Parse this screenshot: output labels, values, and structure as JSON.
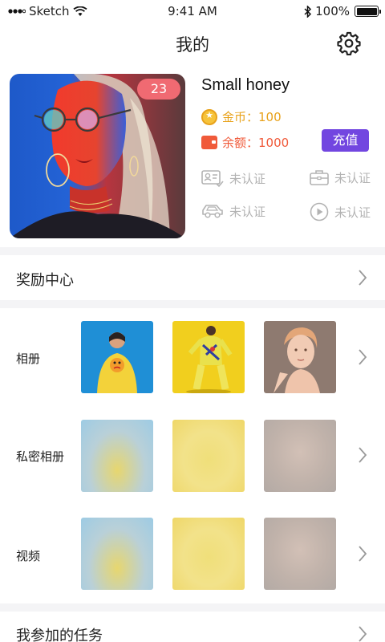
{
  "status_bar": {
    "carrier": "Sketch",
    "time": "9:41 AM",
    "battery": "100%"
  },
  "nav": {
    "title": "我的",
    "settings_icon": "gear-icon"
  },
  "profile": {
    "age": "23",
    "name": "Small honey",
    "coins_label": "金币：",
    "coins_value": "100",
    "balance_label": "余额：",
    "balance_value": "1000",
    "recharge_label": "充值",
    "certifications": [
      {
        "icon": "id-card-icon",
        "label": "未认证"
      },
      {
        "icon": "briefcase-icon",
        "label": "未认证"
      },
      {
        "icon": "car-icon",
        "label": "未认证"
      },
      {
        "icon": "video-play-icon",
        "label": "未认证"
      }
    ]
  },
  "rewards": {
    "label": "奖励中心"
  },
  "albums": {
    "photo_album": "相册",
    "private_album": "私密相册",
    "video": "视频"
  },
  "tasks": {
    "label": "我参加的任务"
  },
  "colors": {
    "accent": "#7246e0",
    "coin": "#e8a21b",
    "balance": "#f05a3a",
    "badge": "#f06a72",
    "muted": "#b3b3b3"
  }
}
